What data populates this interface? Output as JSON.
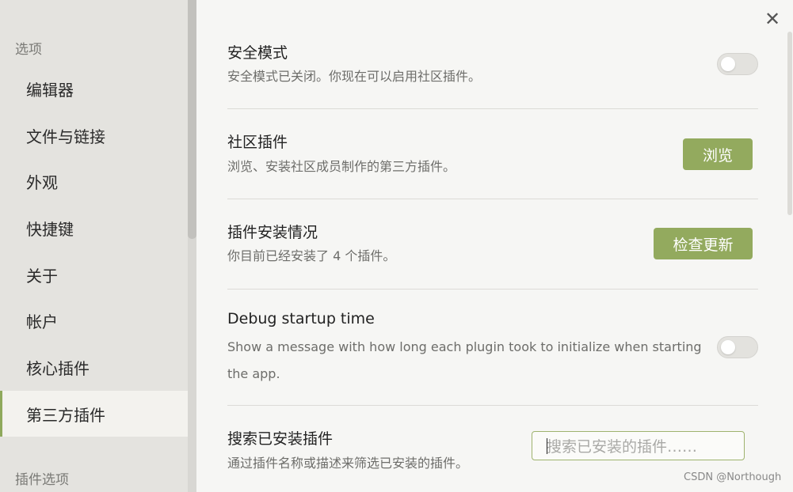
{
  "sidebar": {
    "section_options": "选项",
    "items": [
      {
        "label": "编辑器"
      },
      {
        "label": "文件与链接"
      },
      {
        "label": "外观"
      },
      {
        "label": "快捷键"
      },
      {
        "label": "关于"
      },
      {
        "label": "帐户"
      },
      {
        "label": "核心插件"
      },
      {
        "label": "第三方插件",
        "active": true
      }
    ],
    "section_plugin_options": "插件选项"
  },
  "close_icon": "✕",
  "settings": {
    "safe_mode": {
      "title": "安全模式",
      "desc": "安全模式已关闭。你现在可以启用社区插件。",
      "toggle_on": false
    },
    "community_plugins": {
      "title": "社区插件",
      "desc": "浏览、安装社区成员制作的第三方插件。",
      "button": "浏览"
    },
    "installed": {
      "title": "插件安装情况",
      "desc": "你目前已经安装了 4 个插件。",
      "button": "检查更新"
    },
    "debug": {
      "title": "Debug startup time",
      "desc_line1": "Show a message with how long each plugin took to initialize when starting",
      "desc_line2": "the app.",
      "toggle_on": false
    },
    "search": {
      "title": "搜索已安装插件",
      "desc": "通过插件名称或描述来筛选已安装的插件。",
      "placeholder": "搜索已安装的插件……"
    }
  },
  "watermark": "CSDN @Northough",
  "colors": {
    "accent": "#93aa5e",
    "sidebar_bg": "#e4e3df",
    "content_bg": "#f6f6f4"
  }
}
